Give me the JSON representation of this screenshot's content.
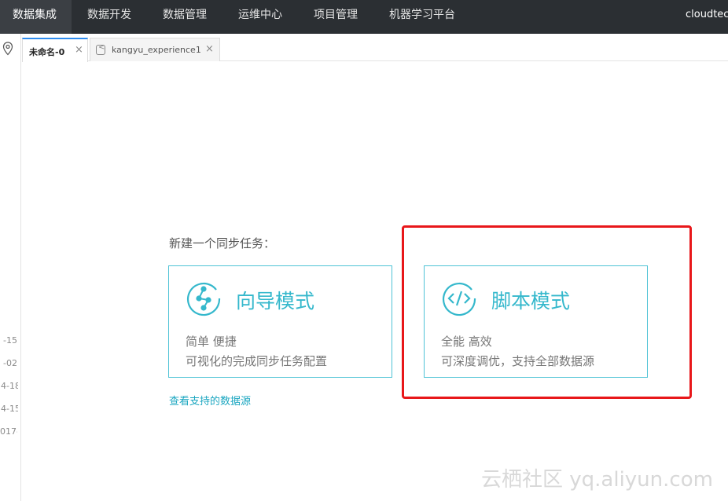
{
  "topnav": {
    "items": [
      {
        "label": "数据集成",
        "active": true
      },
      {
        "label": "数据开发"
      },
      {
        "label": "数据管理"
      },
      {
        "label": "运维中心"
      },
      {
        "label": "项目管理"
      },
      {
        "label": "机器学习平台"
      }
    ],
    "user": "cloudtec"
  },
  "leftrail": {
    "icon": "location-pin-icon",
    "dates": [
      "-15",
      "-02",
      "4-18",
      "4-15",
      "017-"
    ]
  },
  "tabs": [
    {
      "label": "未命名-0",
      "close": "×",
      "active": true
    },
    {
      "label": "kangyu_experience1",
      "close": "×",
      "icon": "code-file-icon"
    }
  ],
  "main": {
    "prompt": "新建一个同步任务：",
    "cards": [
      {
        "title": "向导模式",
        "sub1": "简单 便捷",
        "sub2": "可视化的完成同步任务配置",
        "icon": "wizard-flow-icon"
      },
      {
        "title": "脚本模式",
        "sub1": "全能 高效",
        "sub2": "可深度调优，支持全部数据源",
        "icon": "code-brackets-icon"
      }
    ],
    "link": "查看支持的数据源"
  },
  "watermark": "云栖社区 yq.aliyun.com",
  "colors": {
    "nav_bg": "#2b2f33",
    "accent": "#35b8cc",
    "card_border": "#4fc3d6",
    "highlight": "#e8171a"
  }
}
